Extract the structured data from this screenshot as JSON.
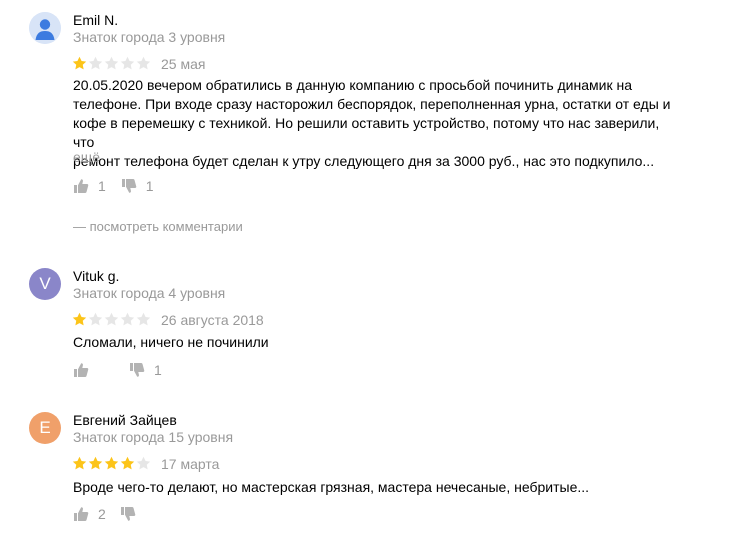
{
  "reviews": [
    {
      "author": "Emil N.",
      "level": "Знаток города 3 уровня",
      "avatar_letter": "",
      "avatar_color": "#d8e4f7",
      "rating": 1,
      "date": "25 мая",
      "text_lines": [
        "20.05.2020 вечером обратились в данную компанию с просьбой починить динамик на",
        "телефоне. При входе сразу насторожил беспорядок, переполненная урна, остатки от еды и",
        "кофе в перемешку с техникой. Но решили оставить устройство, потому что нас заверили, что",
        "ремонт телефона будет сделан к утру следующего дня за 3000 руб., нас это подкупило..."
      ],
      "more_label": "ещё",
      "likes": "1",
      "dislikes": "1",
      "comments_label": "— посмотреть комментарии"
    },
    {
      "author": "Vituk g.",
      "level": "Знаток города 4 уровня",
      "avatar_letter": "V",
      "avatar_color": "#8a86c9",
      "rating": 1,
      "date": "26 августа 2018",
      "text": "Сломали, ничего не починили",
      "likes": "",
      "dislikes": "1"
    },
    {
      "author": "Евгений Зайцев",
      "level": "Знаток города 15 уровня",
      "avatar_letter": "E",
      "avatar_color": "#f0a06a",
      "rating": 4,
      "date": "17 марта",
      "text": "Вроде чего-то делают, но мастерская грязная, мастера нечесаные, небритые...",
      "likes": "2",
      "dislikes": ""
    }
  ],
  "colors": {
    "star_filled": "#fcc419",
    "star_empty": "#e6e6e6",
    "muted_text": "#999999",
    "icon": "#b3b3b3"
  },
  "icons": {
    "like": "thumbs-up-icon",
    "dislike": "thumbs-down-icon",
    "avatar_placeholder": "user-silhouette-icon"
  }
}
